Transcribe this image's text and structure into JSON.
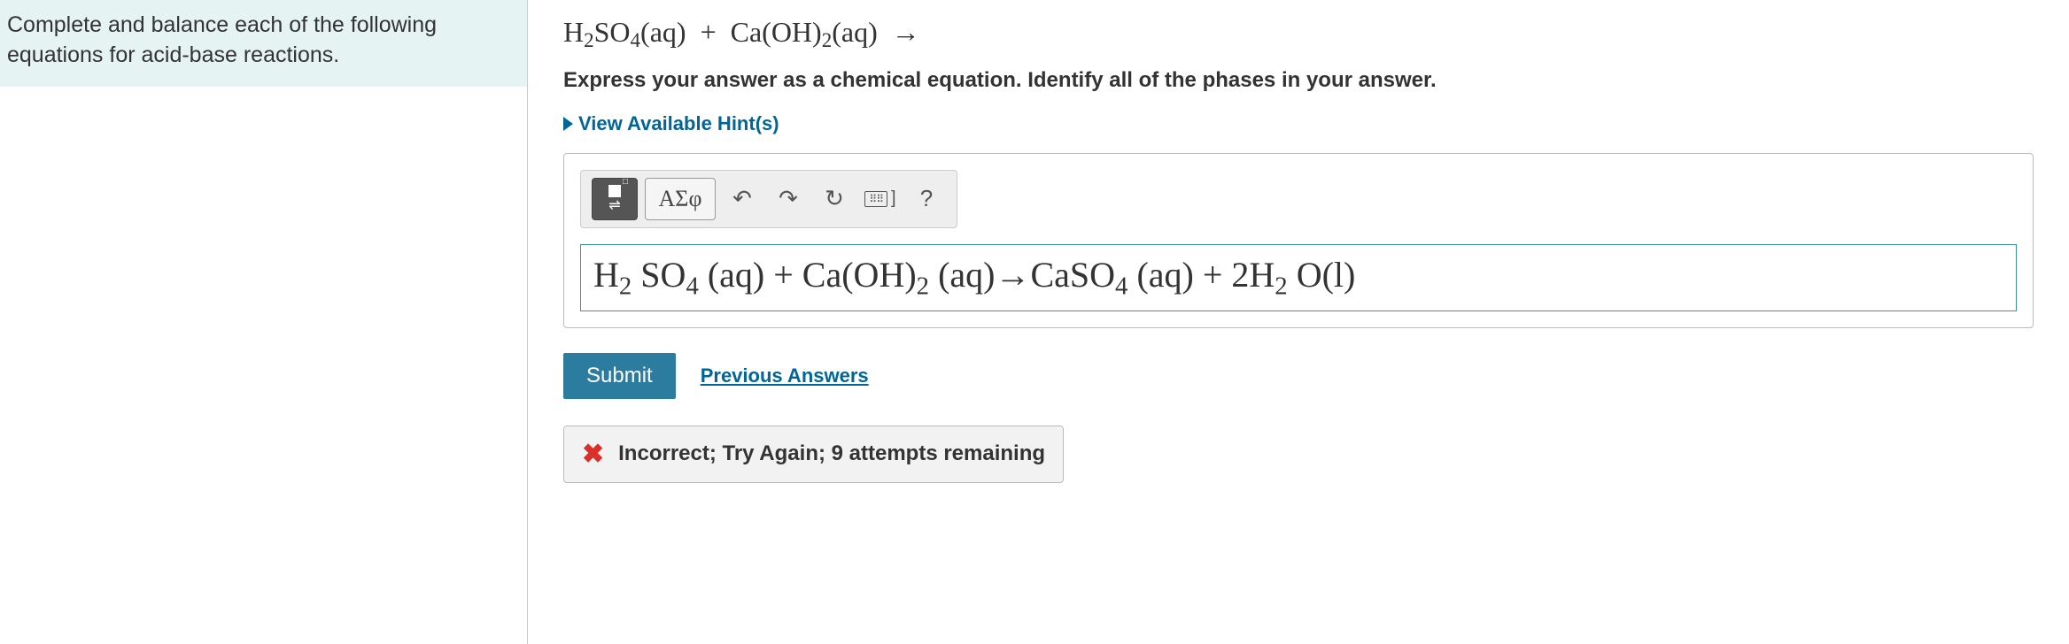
{
  "left": {
    "instruction": "Complete and balance each of the following equations for acid-base reactions."
  },
  "right": {
    "prompt_html": "H<span class='sub'>2</span>SO<span class='sub'>4</span>(aq) &nbsp;+&nbsp; Ca(OH)<span class='sub'>2</span>(aq) &nbsp;→",
    "instruction_bold": "Express your answer as a chemical equation. Identify all of the phases in your answer.",
    "hints_label": "View Available Hint(s)",
    "toolbar": {
      "template_label": "□⇌",
      "greek_label": "ΑΣφ",
      "undo_label": "↶",
      "redo_label": "↷",
      "reset_label": "↻",
      "keyboard_label": "⌨ ]",
      "help_label": "?"
    },
    "answer_html": "H<span class='sub'>2</span> SO<span class='sub'>4</span> (aq) + Ca(OH)<span class='sub'>2</span> (aq)→CaSO<span class='sub'>4</span> (aq) + 2H<span class='sub'>2</span> O(l)",
    "submit_label": "Submit",
    "previous_answers_label": "Previous Answers",
    "feedback": "Incorrect; Try Again; 9 attempts remaining"
  }
}
